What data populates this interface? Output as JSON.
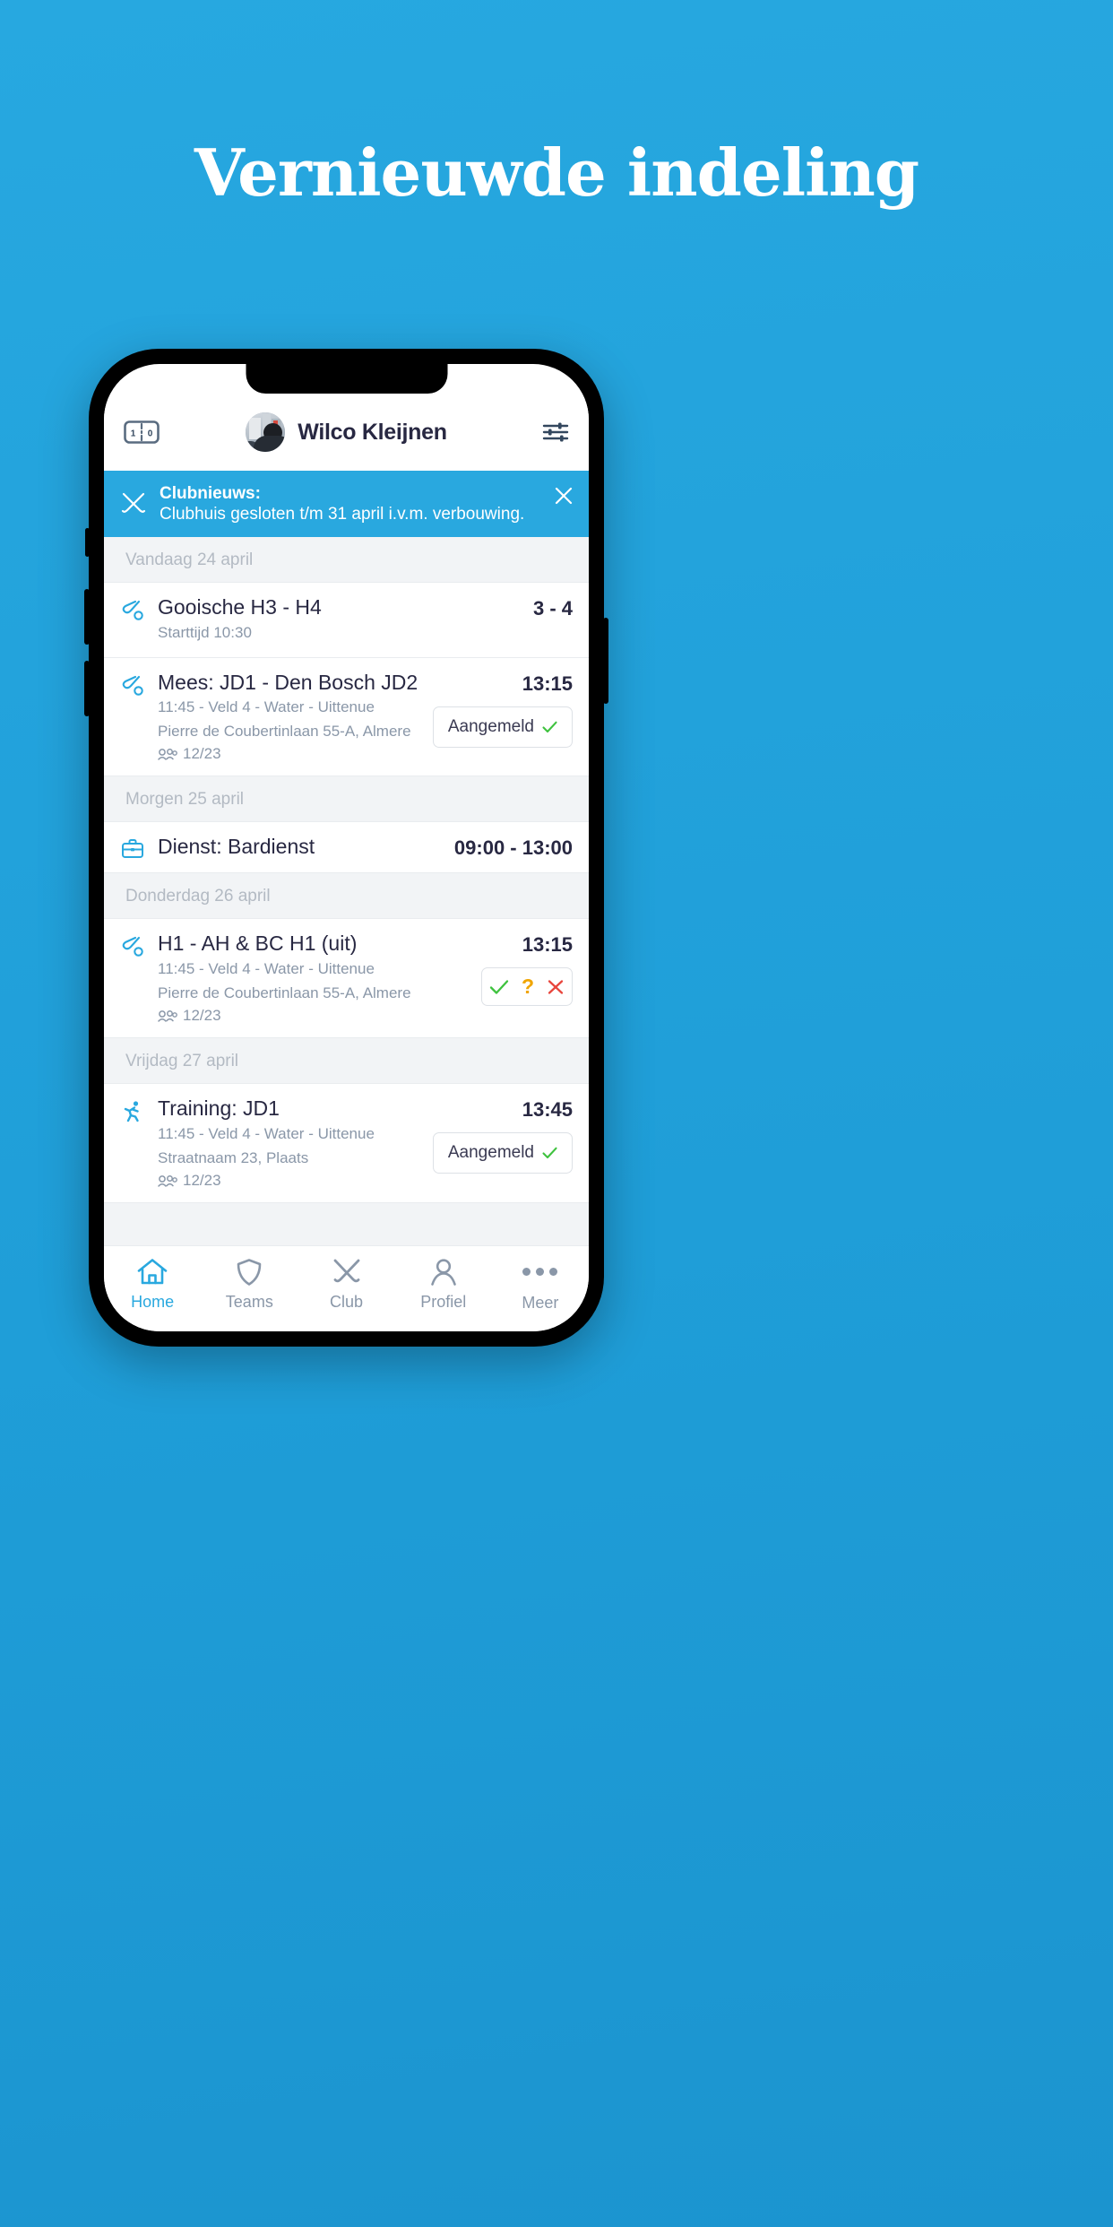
{
  "page": {
    "headline": "Vernieuwde indeling",
    "background_color": "#26a6de"
  },
  "header": {
    "scoreboard_icon": "scoreboard-icon",
    "scoreboard_home": "1",
    "scoreboard_away": "0",
    "avatar_icon": "avatar",
    "user_name": "Wilco Kleijnen",
    "settings_icon": "sliders-icon"
  },
  "banner": {
    "icon": "crossed-hockey-sticks-icon",
    "title": "Clubnieuws:",
    "subtitle": "Clubhuis gesloten t/m 31 april i.v.m. verbouwing.",
    "close_icon": "close-icon",
    "color": "#29a8df"
  },
  "agenda": [
    {
      "day_label": "Vandaag 24 april",
      "items": [
        {
          "icon": "hockey-stick-ball-icon",
          "title": "Gooische H3 - H4",
          "line1": "Starttijd 10:30",
          "line2": "",
          "attendance": "",
          "right_value": "3 - 4",
          "action": "none"
        },
        {
          "icon": "hockey-stick-ball-icon",
          "title": "Mees: JD1 - Den Bosch JD2",
          "line1": "11:45 - Veld 4 - Water - Uittenue",
          "line2": "Pierre de Coubertinlaan 55-A, Almere",
          "attendance": "12/23",
          "right_value": "13:15",
          "action": "aangemeld",
          "action_label": "Aangemeld"
        }
      ]
    },
    {
      "day_label": "Morgen 25 april",
      "items": [
        {
          "icon": "briefcase-icon",
          "title": "Dienst: Bardienst",
          "line1": "",
          "line2": "",
          "attendance": "",
          "right_value": "09:00 - 13:00",
          "action": "none"
        }
      ]
    },
    {
      "day_label": "Donderdag 26 april",
      "items": [
        {
          "icon": "hockey-stick-ball-icon",
          "title": "H1 - AH & BC H1 (uit)",
          "line1": "11:45 - Veld 4 - Water - Uittenue",
          "line2": "Pierre de Coubertinlaan 55-A, Almere",
          "attendance": "12/23",
          "right_value": "13:15",
          "action": "triple",
          "yes_icon": "check-icon",
          "maybe_icon": "question-icon",
          "no_icon": "cross-icon"
        }
      ]
    },
    {
      "day_label": "Vrijdag 27 april",
      "items": [
        {
          "icon": "running-person-icon",
          "title": "Training: JD1",
          "line1": "11:45 - Veld 4 - Water - Uittenue",
          "line2": "Straatnaam 23, Plaats",
          "attendance": "12/23",
          "right_value": "13:45",
          "action": "aangemeld",
          "action_label": "Aangemeld"
        }
      ]
    }
  ],
  "tabbar": {
    "items": [
      {
        "label": "Home",
        "icon": "home-icon",
        "active": true
      },
      {
        "label": "Teams",
        "icon": "shield-icon",
        "active": false
      },
      {
        "label": "Club",
        "icon": "crossed-sticks-icon",
        "active": false
      },
      {
        "label": "Profiel",
        "icon": "person-icon",
        "active": false
      },
      {
        "label": "Meer",
        "icon": "ellipsis-icon",
        "active": false
      }
    ]
  }
}
